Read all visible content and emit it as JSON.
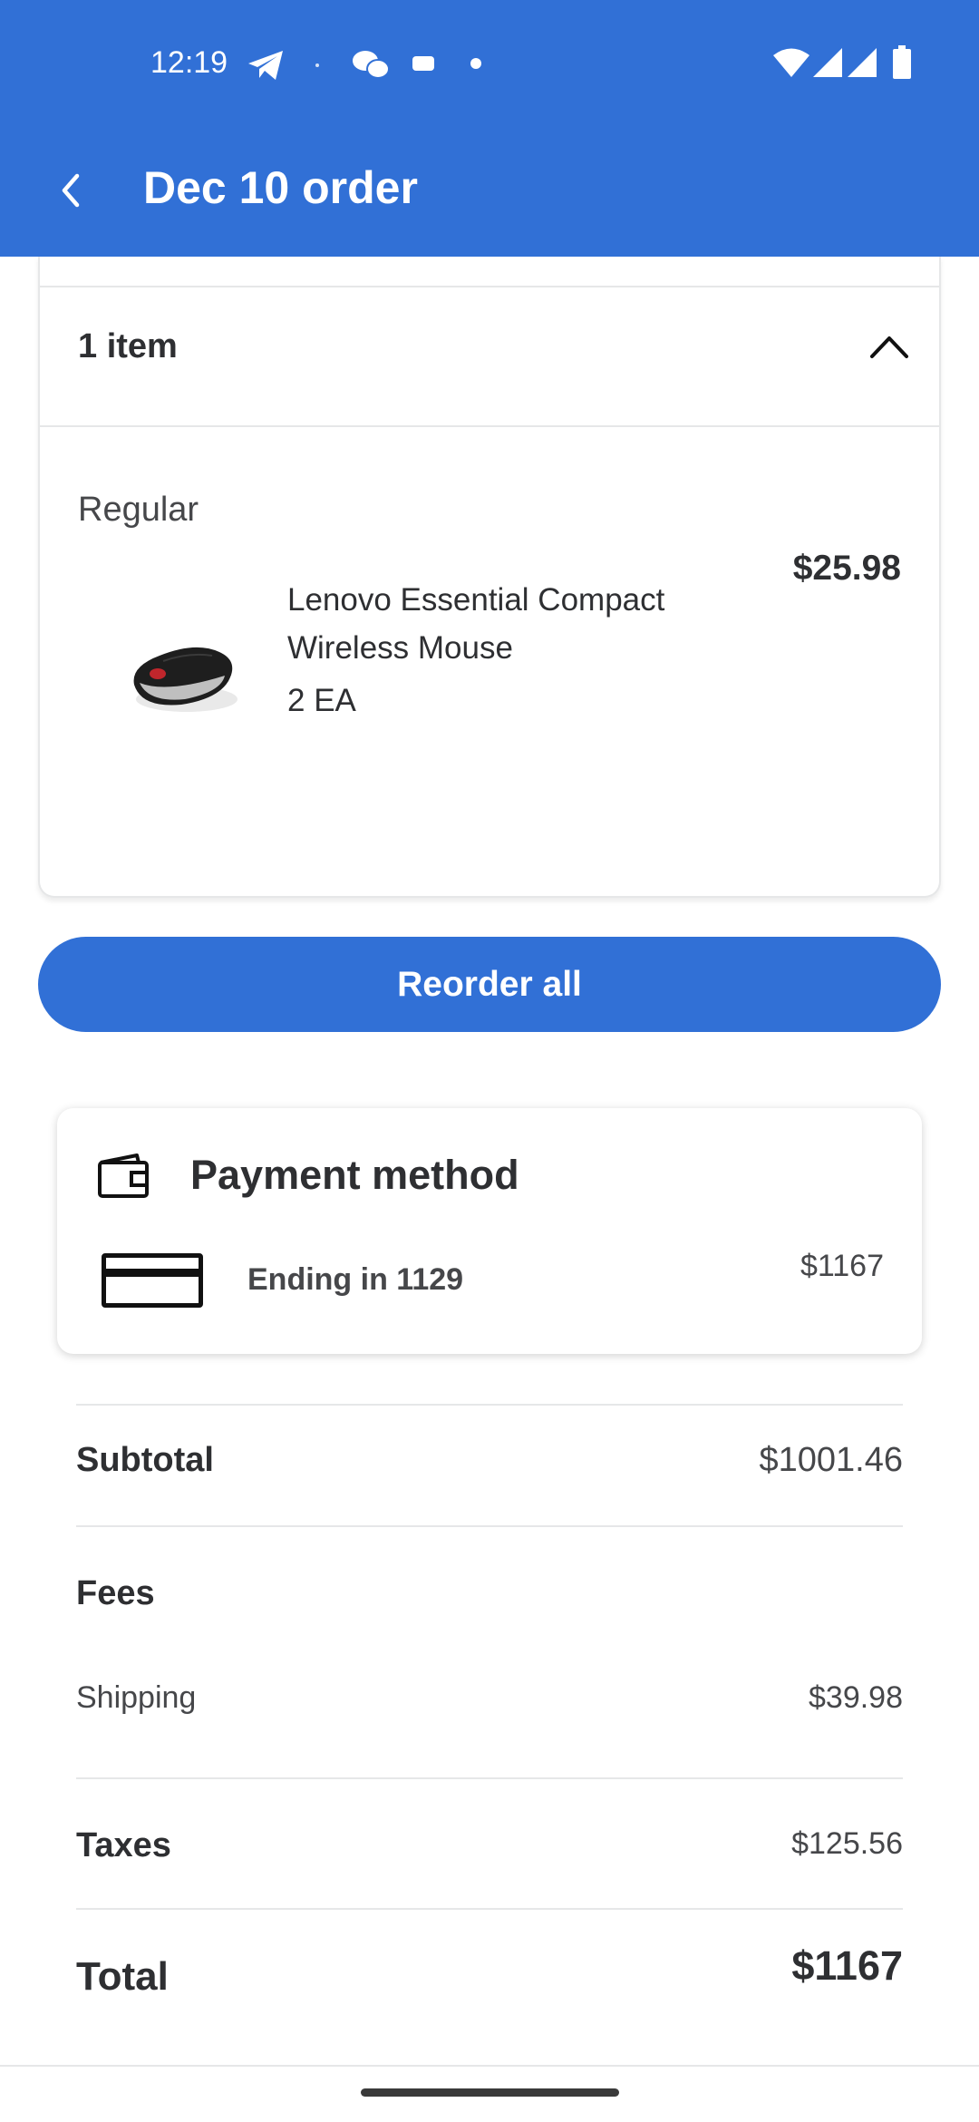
{
  "status_bar": {
    "time": "12:19",
    "icons": [
      "telegram-icon",
      "wechat-icon",
      "message-icon",
      "dot-icon",
      "wifi-icon",
      "signal-icon",
      "signal-icon",
      "battery-icon"
    ]
  },
  "app_bar": {
    "back_icon": "back-arrow-icon",
    "title": "Dec 10 order"
  },
  "items_section": {
    "header": "1 item",
    "toggle_icon": "chevron-up-icon",
    "group_label": "Regular",
    "product": {
      "name": "Lenovo Essential Compact Wireless Mouse",
      "quantity": "2 EA",
      "price": "$25.98",
      "image": "wireless-mouse-image"
    }
  },
  "reorder_button": "Reorder all",
  "payment": {
    "title": "Payment method",
    "wallet_icon": "wallet-icon",
    "card_icon": "credit-card-icon",
    "card_label": "Ending in 1129",
    "amount": "$1167"
  },
  "summary": {
    "subtotal_label": "Subtotal",
    "subtotal_value": "$1001.46",
    "fees_label": "Fees",
    "shipping_label": "Shipping",
    "shipping_value": "$39.98",
    "taxes_label": "Taxes",
    "taxes_value": "$125.56",
    "total_label": "Total",
    "total_value": "$1167"
  },
  "colors": {
    "brand_blue": "#3170d6",
    "text_dark": "#2e2f32",
    "divider": "#e6e7e8"
  }
}
